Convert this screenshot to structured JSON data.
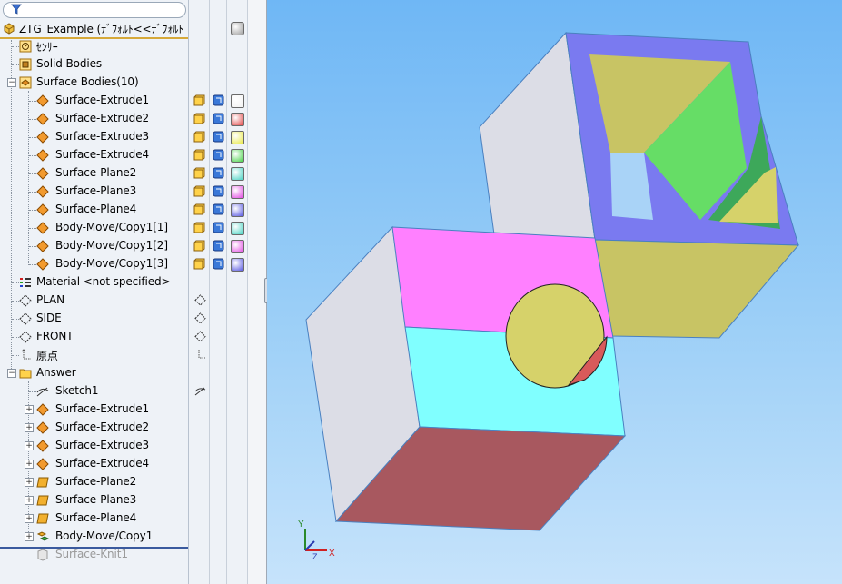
{
  "tree": {
    "root": "ZTG_Example  (ﾃﾞﾌｫﾙﾄ<<ﾃﾞﾌｫﾙﾄ",
    "sensors": "ｾﾝｻｰ",
    "solid_bodies": "Solid Bodies",
    "surface_bodies": "Surface Bodies(10)",
    "surface_body_items": [
      "Surface-Extrude1",
      "Surface-Extrude2",
      "Surface-Extrude3",
      "Surface-Extrude4",
      "Surface-Plane2",
      "Surface-Plane3",
      "Surface-Plane4",
      "Body-Move/Copy1[1]",
      "Body-Move/Copy1[2]",
      "Body-Move/Copy1[3]"
    ],
    "material": "Material <not specified>",
    "plane_plan": "PLAN",
    "plane_side": "SIDE",
    "plane_front": "FRONT",
    "origin": "原点",
    "folder_answer": "Answer",
    "answer_items": [
      "Sketch1",
      "Surface-Extrude1",
      "Surface-Extrude2",
      "Surface-Extrude3",
      "Surface-Extrude4",
      "Surface-Plane2",
      "Surface-Plane3",
      "Surface-Plane4",
      "Body-Move/Copy1"
    ],
    "suppressed": "Surface-Knit1"
  },
  "display_pane": {
    "swatch_colors": [
      "#f2f2f2",
      "#e04040",
      "#e8e840",
      "#40d040",
      "#40d0c0",
      "#e040e0",
      "#5050e0",
      "#40d0c0",
      "#e040e0",
      "#5050e0"
    ],
    "root_swatch": "#9a9a9a"
  },
  "viewport": {
    "colors": {
      "grey_face": "#dcdde6",
      "magenta_face": "#ff80ff",
      "cyan_face": "#80ffff",
      "bottom_face": "#a8585f",
      "olive_face": "#c8c464",
      "blue_frame": "#7a7af0",
      "green_face": "#66dd66",
      "dark_green": "#3da85a",
      "hole_yellow": "#d6d26a",
      "hole_red": "#d85a5a"
    },
    "triad": {
      "x": "X",
      "y": "Y",
      "z": "Z"
    }
  }
}
